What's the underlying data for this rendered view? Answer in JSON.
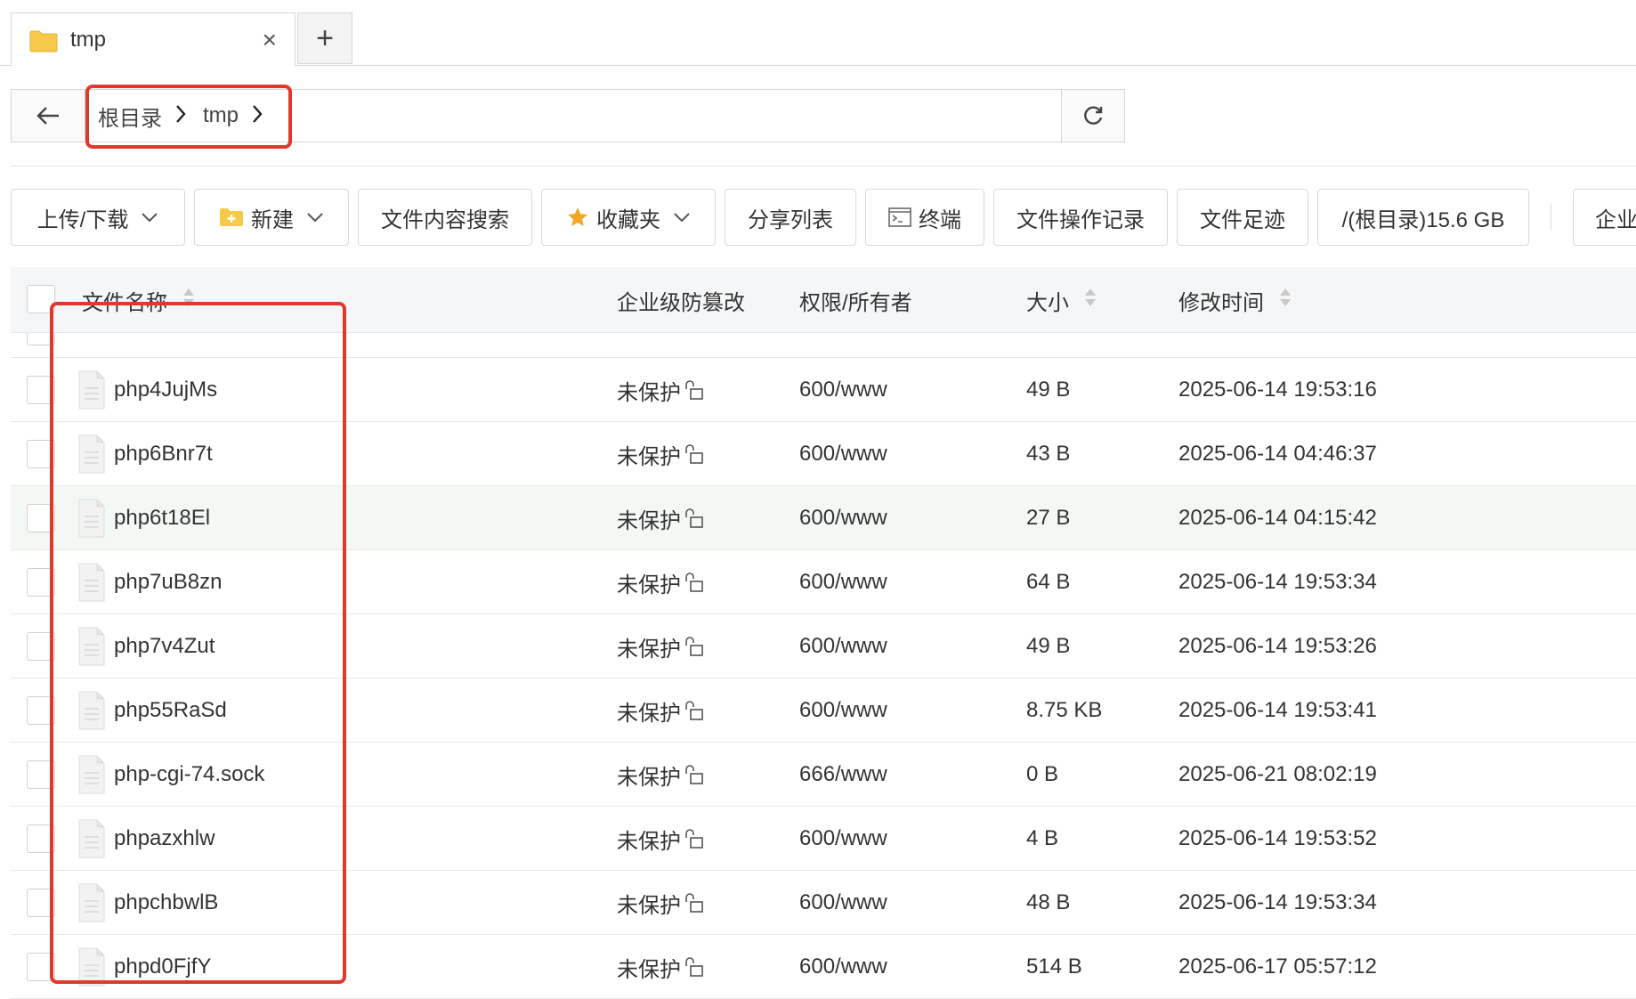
{
  "tab": {
    "label": "tmp",
    "close": "×",
    "new_tab": "+"
  },
  "address": {
    "back": "←",
    "crumbs": [
      "根目录",
      "tmp"
    ],
    "separator": "›"
  },
  "toolbar": {
    "upload_download": "上传/下载",
    "new": "新建",
    "content_search": "文件内容搜索",
    "favorites": "收藏夹",
    "share_list": "分享列表",
    "terminal": "终端",
    "op_log": "文件操作记录",
    "footprint": "文件足迹",
    "disk": "/(根目录)15.6 GB",
    "enterprise": "企业"
  },
  "table": {
    "headers": {
      "name": "文件名称",
      "tamper": "企业级防篡改",
      "perm": "权限/所有者",
      "size": "大小",
      "mtime": "修改时间"
    },
    "rows": [
      {
        "name": "php4JujMs",
        "tamper": "未保护",
        "perm": "600/www",
        "size": "49 B",
        "mtime": "2025-06-14 19:53:16"
      },
      {
        "name": "php6Bnr7t",
        "tamper": "未保护",
        "perm": "600/www",
        "size": "43 B",
        "mtime": "2025-06-14 04:46:37"
      },
      {
        "name": "php6t18El",
        "tamper": "未保护",
        "perm": "600/www",
        "size": "27 B",
        "mtime": "2025-06-14 04:15:42"
      },
      {
        "name": "php7uB8zn",
        "tamper": "未保护",
        "perm": "600/www",
        "size": "64 B",
        "mtime": "2025-06-14 19:53:34"
      },
      {
        "name": "php7v4Zut",
        "tamper": "未保护",
        "perm": "600/www",
        "size": "49 B",
        "mtime": "2025-06-14 19:53:26"
      },
      {
        "name": "php55RaSd",
        "tamper": "未保护",
        "perm": "600/www",
        "size": "8.75 KB",
        "mtime": "2025-06-14 19:53:41"
      },
      {
        "name": "php-cgi-74.sock",
        "tamper": "未保护",
        "perm": "666/www",
        "size": "0 B",
        "mtime": "2025-06-21 08:02:19"
      },
      {
        "name": "phpazxhlw",
        "tamper": "未保护",
        "perm": "600/www",
        "size": "4 B",
        "mtime": "2025-06-14 19:53:52"
      },
      {
        "name": "phpchbwlB",
        "tamper": "未保护",
        "perm": "600/www",
        "size": "48 B",
        "mtime": "2025-06-14 19:53:34"
      },
      {
        "name": "phpd0FjfY",
        "tamper": "未保护",
        "perm": "600/www",
        "size": "514 B",
        "mtime": "2025-06-17 05:57:12"
      }
    ]
  },
  "colors": {
    "annotation": "#e0392b",
    "highlight_row": "#f4f8f5",
    "folder": "#f7c948"
  }
}
